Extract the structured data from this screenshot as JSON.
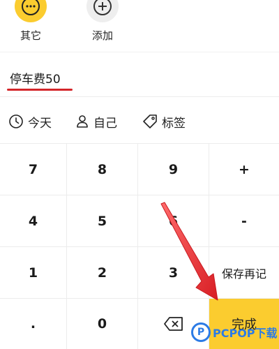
{
  "categories": [
    {
      "label": "其它",
      "icon": "more-icon"
    },
    {
      "label": "添加",
      "icon": "plus-icon"
    }
  ],
  "note": {
    "text": "停车费50"
  },
  "meta": {
    "today": "今天",
    "self": "自己",
    "tag": "标签"
  },
  "keypad": {
    "k7": "7",
    "k8": "8",
    "k9": "9",
    "plus": "+",
    "k4": "4",
    "k5": "5",
    "k6": "6",
    "minus": "-",
    "k1": "1",
    "k2": "2",
    "k3": "3",
    "save_again": "保存再记",
    "dot": ".",
    "k0": "0",
    "done": "完成"
  },
  "watermark": {
    "logo": "P",
    "text": "PCPOP下载"
  },
  "colors": {
    "accent_yellow": "#fbcc2f",
    "annotation_red": "#e0262c",
    "underline_red": "#d4252a",
    "watermark_blue": "#2c7be5"
  }
}
